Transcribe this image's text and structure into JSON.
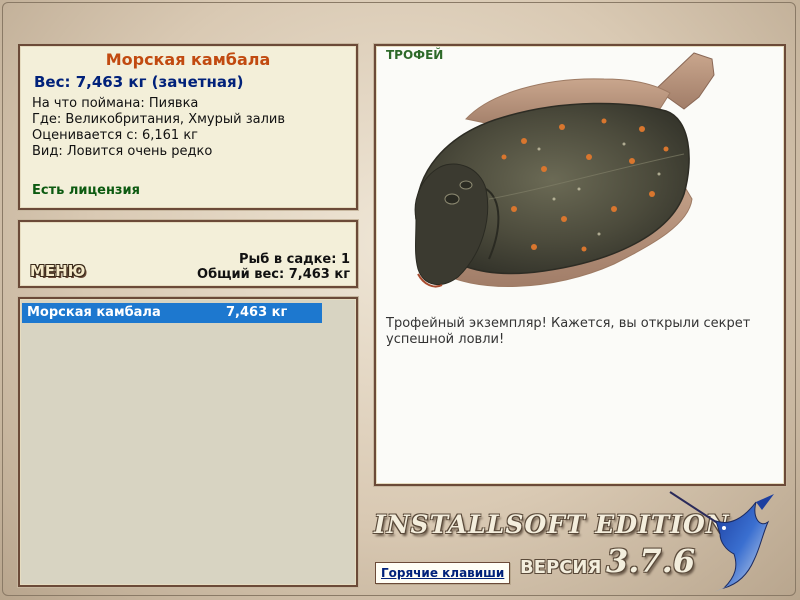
{
  "info": {
    "title": "Морская камбала",
    "weight": "Вес: 7,463 кг (зачетная)",
    "bait": "На что поймана: Пиявка",
    "location": "Где: Великобритания, Хмурый залив",
    "estimated": "Оценивается с: 6,161 кг",
    "rarity": "Вид: Ловится очень редко",
    "license": "Есть лицензия"
  },
  "menu": {
    "label": "МЕНЮ",
    "fish_count": "Рыб в садке: 1",
    "total_weight": "Общий вес: 7,463 кг"
  },
  "catch_list": [
    {
      "name": "Морская камбала",
      "weight": "7,463 кг",
      "selected": true
    }
  ],
  "trophy": {
    "badge": "ТРОФЕЙ",
    "fish_image": "flounder-image",
    "description": "Трофейный экземпляр! Кажется, вы открыли секрет успешной ловли!"
  },
  "branding": {
    "edition": "INSTALLSOFT EDITION",
    "version_label": "ВЕРСИЯ",
    "version": "3.7.6",
    "mascot": "marlin-fish-logo"
  },
  "footer": {
    "hotkeys_label": "Горячие клавиши"
  },
  "colors": {
    "title": "#c14a10",
    "weight": "#00217a",
    "license": "#0c5a10",
    "selection": "#1d78cf",
    "panel_border": "#6b4a38",
    "panel_bg": "#f3efd9"
  }
}
